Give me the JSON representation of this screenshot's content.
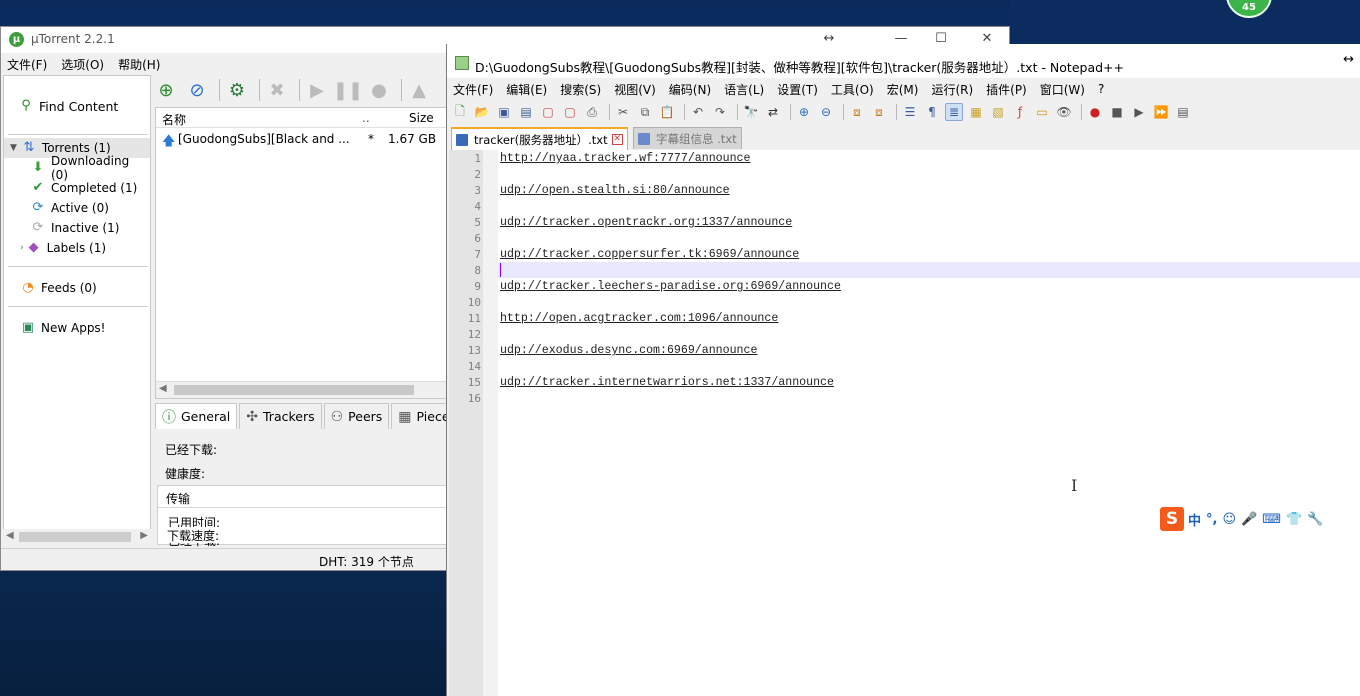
{
  "desktop": {
    "badge": "45"
  },
  "utorrent": {
    "title": "µTorrent 2.2.1",
    "menu": [
      "文件(F)",
      "选项(O)",
      "帮助(H)"
    ],
    "sidebar": {
      "find_content": "Find Content",
      "torrents": "Torrents (1)",
      "downloading": "Downloading (0)",
      "completed": "Completed (1)",
      "active": "Active (0)",
      "inactive": "Inactive (1)",
      "labels": "Labels (1)",
      "feeds": "Feeds (0)",
      "new_apps": "New Apps!"
    },
    "list": {
      "col_name": "名称",
      "col_dots": "..",
      "col_size": "Size",
      "row": {
        "name": "[GuodongSubs][Black and ...",
        "flag": "*",
        "size": "1.67 GB"
      }
    },
    "tabs": [
      "General",
      "Trackers",
      "Peers",
      "Pieces"
    ],
    "detail": {
      "downloaded": "已经下载:",
      "health": "健康度:",
      "transfer": "传输",
      "elapsed": "已用时间:",
      "downloaded2": "已经下载:",
      "speed": "下载速度:"
    },
    "status": "DHT: 319 个节点"
  },
  "notepad": {
    "title": "D:\\GuodongSubs教程\\[GuodongSubs教程][封装、做种等教程][软件包]\\tracker(服务器地址）.txt - Notepad++",
    "menu": [
      "文件(F)",
      "编辑(E)",
      "搜索(S)",
      "视图(V)",
      "编码(N)",
      "语言(L)",
      "设置(T)",
      "工具(O)",
      "宏(M)",
      "运行(R)",
      "插件(P)",
      "窗口(W)",
      "?"
    ],
    "tabs": [
      {
        "label": "tracker(服务器地址）.txt",
        "active": true
      },
      {
        "label": "字幕组信息 .txt",
        "active": false
      }
    ],
    "lines": [
      "http://nyaa.tracker.wf:7777/announce",
      "",
      "udp://open.stealth.si:80/announce",
      "",
      "udp://tracker.opentrackr.org:1337/announce",
      "",
      "udp://tracker.coppersurfer.tk:6969/announce",
      "",
      "udp://tracker.leechers-paradise.org:6969/announce",
      "",
      "http://open.acgtracker.com:1096/announce",
      "",
      "udp://exodus.desync.com:6969/announce",
      "",
      "udp://tracker.internetwarriors.net:1337/announce",
      ""
    ],
    "line_numbers": [
      "1",
      "2",
      "3",
      "4",
      "5",
      "6",
      "7",
      "8",
      "9",
      "10",
      "11",
      "12",
      "13",
      "14",
      "15",
      "16"
    ]
  },
  "ime": {
    "logo": "S",
    "lang": "中",
    "punct": "°,"
  }
}
